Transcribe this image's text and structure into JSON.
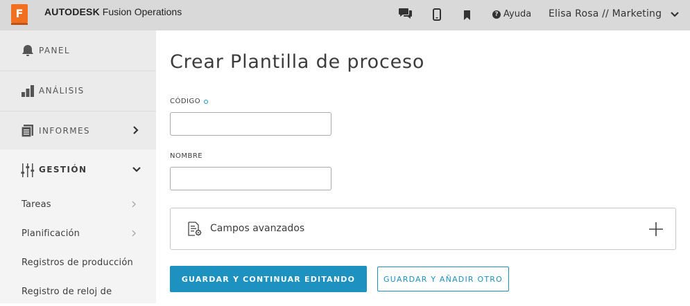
{
  "app": {
    "logo_letter": "F",
    "brand_bold": "AUTODESK",
    "brand_rest": " Fusion Operations",
    "help_label": "Ayuda",
    "user_label": "Elisa Rosa // Marketing"
  },
  "topbar_icons": [
    "chat-icon",
    "mobile-icon",
    "bookmark-icon",
    "help-icon",
    "chevron-down-icon"
  ],
  "sidebar": {
    "items": [
      {
        "label": "PANEL",
        "icon": "bell-icon"
      },
      {
        "label": "ANÁLISIS",
        "icon": "bar-chart-icon"
      },
      {
        "label": "INFORMES",
        "icon": "reports-icon"
      },
      {
        "label": "GESTIÓN",
        "icon": "sliders-icon"
      }
    ],
    "subitems": [
      {
        "label": "Tareas"
      },
      {
        "label": "Planificación"
      },
      {
        "label": "Registros de producción"
      },
      {
        "label": "Registro de reloj de"
      }
    ]
  },
  "form": {
    "title": "Crear Plantilla de proceso",
    "code_label": "CÓDIGO",
    "code_value": "",
    "name_label": "NOMBRE",
    "name_value": "",
    "advanced_label": "Campos avanzados",
    "save_continue_label": "GUARDAR Y CONTINUAR EDITANDO",
    "save_add_label": "GUARDAR Y AÑADIR OTRO"
  },
  "colors": {
    "accent": "#1d91c0",
    "logo": "#f06f21",
    "topbar": "#d9d9d9",
    "sidebar": "#ebebeb"
  }
}
